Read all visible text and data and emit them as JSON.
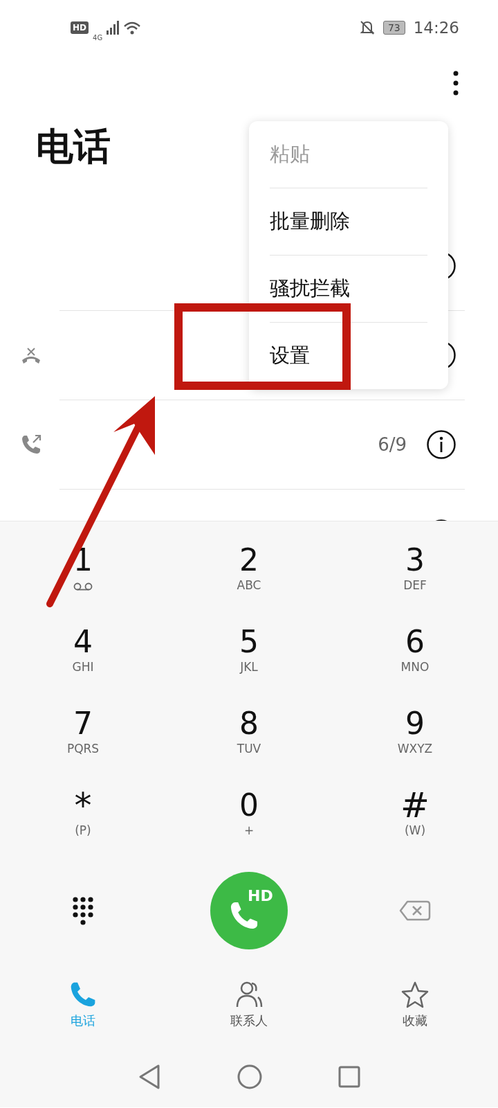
{
  "status_bar": {
    "hd": "HD",
    "network": "4G",
    "battery": "73",
    "time": "14:26"
  },
  "title": "电话",
  "menu": [
    {
      "label": "粘贴",
      "disabled": true
    },
    {
      "label": "批量删除",
      "disabled": false
    },
    {
      "label": "骚扰拦截",
      "disabled": false
    },
    {
      "label": "设置",
      "disabled": false
    }
  ],
  "calls": [
    {
      "info": true
    },
    {
      "kind": "missed",
      "info": true
    },
    {
      "kind": "outgoing",
      "count": "6/9",
      "info": true
    },
    {
      "info": true
    }
  ],
  "keypad": [
    {
      "digit": "1",
      "kind": "voicemail"
    },
    {
      "digit": "2",
      "letters": "ABC"
    },
    {
      "digit": "3",
      "letters": "DEF"
    },
    {
      "digit": "4",
      "letters": "GHI"
    },
    {
      "digit": "5",
      "letters": "JKL"
    },
    {
      "digit": "6",
      "letters": "MNO"
    },
    {
      "digit": "7",
      "letters": "PQRS"
    },
    {
      "digit": "8",
      "letters": "TUV"
    },
    {
      "digit": "9",
      "letters": "WXYZ"
    },
    {
      "digit": "*",
      "letters": "(P)"
    },
    {
      "digit": "0",
      "letters": "+"
    },
    {
      "digit": "#",
      "letters": "(W)"
    }
  ],
  "call_button": {
    "label": "HD"
  },
  "tabs": [
    {
      "label": "电话",
      "kind": "phone",
      "selected": true
    },
    {
      "label": "联系人",
      "kind": "contacts",
      "selected": false
    },
    {
      "label": "收藏",
      "kind": "favorites",
      "selected": false
    }
  ],
  "annotations": {
    "highlight_box": true,
    "arrow": true
  }
}
